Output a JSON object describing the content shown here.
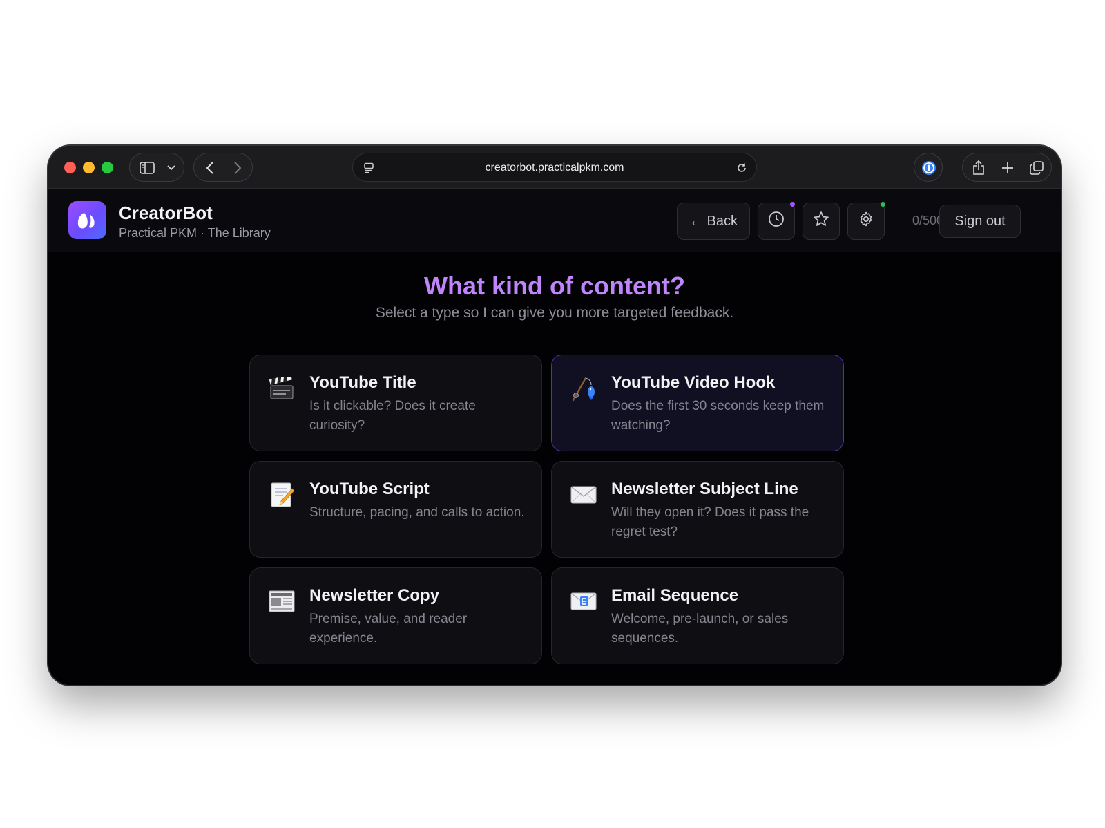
{
  "browser": {
    "url": "creatorbot.practicalpkm.com"
  },
  "app": {
    "name": "CreatorBot",
    "subtitle": "Practical PKM · The Library",
    "back_label": "← Back",
    "usage": "0/500",
    "signout_label": "Sign out",
    "accent": "#c084fc",
    "history_dot_color": "#a855f7",
    "settings_dot_color": "#22c55e"
  },
  "main": {
    "headline": "What kind of content?",
    "subhead": "Select a type so I can give you more targeted feedback.",
    "cards": [
      {
        "title": "YouTube Title",
        "desc": "Is it clickable? Does it create curiosity?",
        "icon": "clapperboard-icon",
        "selected": false
      },
      {
        "title": "YouTube Video Hook",
        "desc": "Does the first 30 seconds keep them watching?",
        "icon": "fishing-pole-icon",
        "selected": true
      },
      {
        "title": "YouTube Script",
        "desc": "Structure, pacing, and calls to action.",
        "icon": "memo-icon",
        "selected": false
      },
      {
        "title": "Newsletter Subject Line",
        "desc": "Will they open it? Does it pass the regret test?",
        "icon": "envelope-icon",
        "selected": false
      },
      {
        "title": "Newsletter Copy",
        "desc": "Premise, value, and reader experience.",
        "icon": "newspaper-icon",
        "selected": false
      },
      {
        "title": "Email Sequence",
        "desc": "Welcome, pre-launch, or sales sequences.",
        "icon": "email-icon",
        "selected": false
      }
    ]
  }
}
